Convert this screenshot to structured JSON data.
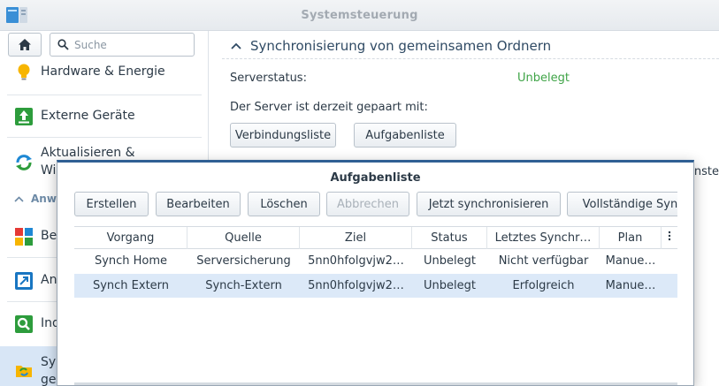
{
  "window": {
    "title": "Systemsteuerung"
  },
  "sidebar": {
    "search_placeholder": "Suche",
    "items": [
      {
        "label": "Hardware & Energie",
        "icon": "lightbulb-icon"
      },
      {
        "label": "Externe Geräte",
        "icon": "external-devices-icon"
      },
      {
        "label": "Aktualisieren &",
        "label2": "Wi",
        "icon": "update-icon"
      },
      {
        "label": "Be",
        "icon": "privileges-icon"
      },
      {
        "label": "An",
        "icon": "application-portal-icon"
      },
      {
        "label": "Ind",
        "icon": "indexing-icon"
      },
      {
        "label": "Sy",
        "label2": "ge",
        "icon": "shared-folder-sync-icon"
      }
    ],
    "section_header": "Anw"
  },
  "main": {
    "section_title": "Synchronisierung von gemeinsamen Ordnern",
    "server_status_label": "Serverstatus:",
    "server_status_value": "Unbelegt",
    "paired_label": "Der Server ist derzeit gepaart mit:",
    "btn_connection_list": "Verbindungsliste",
    "btn_task_list": "Aufgabenliste",
    "cut_text": "nste"
  },
  "dialog": {
    "title": "Aufgabenliste",
    "toolbar": {
      "create": "Erstellen",
      "edit": "Bearbeiten",
      "delete": "Löschen",
      "cancel": "Abbrechen",
      "sync_now": "Jetzt synchronisieren",
      "full_sync": "Vollständige Sync"
    },
    "columns": [
      "Vorgang",
      "Quelle",
      "Ziel",
      "Status",
      "Letztes Synchr…",
      "Plan"
    ],
    "rows": [
      [
        "Synch Home",
        "Serversicherung",
        "5nn0hfolgvjw2…",
        "Unbelegt",
        "Nicht verfügbar",
        "Manue…"
      ],
      [
        "Synch Extern",
        "Synch-Extern",
        "5nn0hfolgvjw2…",
        "Unbelegt",
        "Erfolgreich",
        "Manue…"
      ]
    ]
  },
  "colors": {
    "accent": "#2f5f93",
    "status_green": "#3fa447",
    "selected_row": "#dce9f8"
  }
}
